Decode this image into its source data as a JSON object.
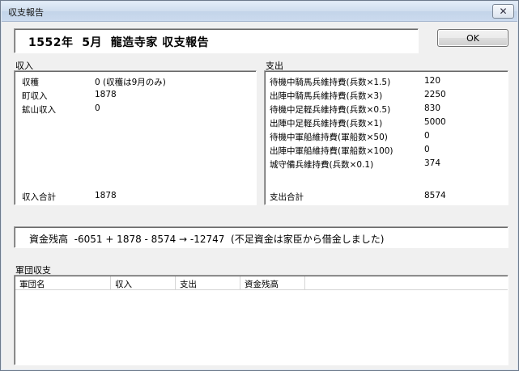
{
  "window": {
    "title": "収支報告",
    "close_glyph": "✕"
  },
  "header": {
    "title": "1552年  5月  龍造寺家 収支報告"
  },
  "ok_button": {
    "label": "OK"
  },
  "income": {
    "section_label": "収入",
    "items": [
      {
        "label": "収穫",
        "value": "0 (収穫は9月のみ)"
      },
      {
        "label": "町収入",
        "value": "1878"
      },
      {
        "label": "鉱山収入",
        "value": "0"
      }
    ],
    "total_label": "収入合計",
    "total_value": "1878"
  },
  "expense": {
    "section_label": "支出",
    "items": [
      {
        "label": "待機中騎馬兵維持費(兵数×1.5)",
        "value": "120"
      },
      {
        "label": "出陣中騎馬兵維持費(兵数×3)",
        "value": "2250"
      },
      {
        "label": "待機中足軽兵維持費(兵数×0.5)",
        "value": "830"
      },
      {
        "label": "出陣中足軽兵維持費(兵数×1)",
        "value": "5000"
      },
      {
        "label": "待機中軍船維持費(軍船数×50)",
        "value": "0"
      },
      {
        "label": "出陣中軍船維持費(軍船数×100)",
        "value": "0"
      },
      {
        "label": "城守備兵維持費(兵数×0.1)",
        "value": "374"
      }
    ],
    "total_label": "支出合計",
    "total_value": "8574"
  },
  "balance": {
    "text": "資金残高  -6051 + 1878 - 8574 → -12747  (不足資金は家臣から借金しました)"
  },
  "army": {
    "section_label": "軍団収支",
    "columns": [
      "軍団名",
      "収入",
      "支出",
      "資金残高"
    ]
  }
}
